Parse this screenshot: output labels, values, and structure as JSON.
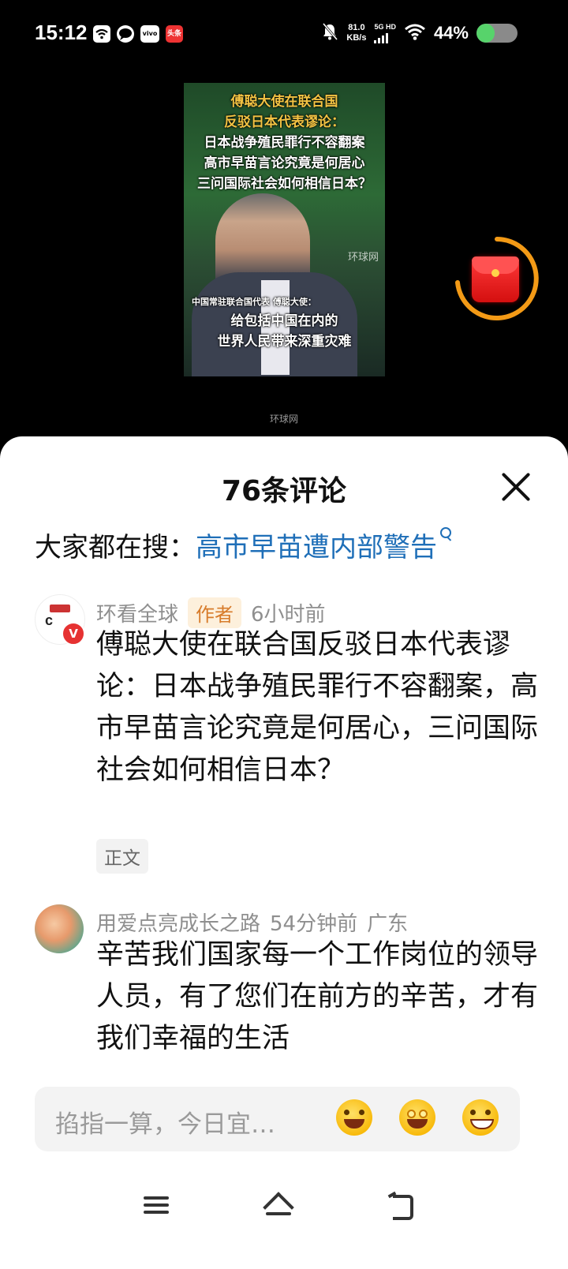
{
  "status_bar": {
    "time": "15:12",
    "net_speed_value": "81.0",
    "net_speed_unit": "KB/s",
    "network_type": "5G HD",
    "battery_percent": "44%",
    "battery_level": 0.44,
    "app_icons": [
      "wifi-notify-icon",
      "chat-icon",
      "vivo-icon",
      "toutiao-icon"
    ]
  },
  "video": {
    "title_lines_gold": [
      "傅聪大使在联合国",
      "反驳日本代表谬论："
    ],
    "title_lines_white": [
      "日本战争殖民罪行不容翻案",
      "高市早苗言论究竟是何居心",
      "三问国际社会如何相信日本？"
    ],
    "caption_small": "中国常驻联合国代表 傅聪大使：",
    "caption_lines": [
      "给包括中国在内的",
      "世界人民带来深重灾难"
    ],
    "inner_watermark": "环球网",
    "watermark": "环球网"
  },
  "comments_panel": {
    "title": "76条评论",
    "search_prefix": "大家都在搜：",
    "search_link": "高市早苗遭内部警告",
    "comments": [
      {
        "username": "环看全球",
        "badge": "作者",
        "time": "6小时前",
        "location": "",
        "text": "傅聪大使在联合国反驳日本代表谬论：日本战争殖民罪行不容翻案，高市早苗言论究竟是何居心，三问国际社会如何相信日本？",
        "tag": "正文",
        "verified_badge": "V"
      },
      {
        "username": "用爱点亮成长之路",
        "badge": "",
        "time": "54分钟前",
        "location": "广东",
        "text": "辛苦我们国家每一个工作岗位的领导人员，有了您们在前方的辛苦，才有我们幸福的生活",
        "tag": "",
        "verified_badge": ""
      }
    ]
  },
  "input_bar": {
    "placeholder": "掐指一算，今日宜…",
    "emojis": [
      "grinning-emoji",
      "star-eyes-emoji",
      "grimacing-emoji"
    ]
  },
  "nav_bar": {
    "buttons": [
      "menu-icon",
      "home-icon",
      "back-icon"
    ]
  }
}
